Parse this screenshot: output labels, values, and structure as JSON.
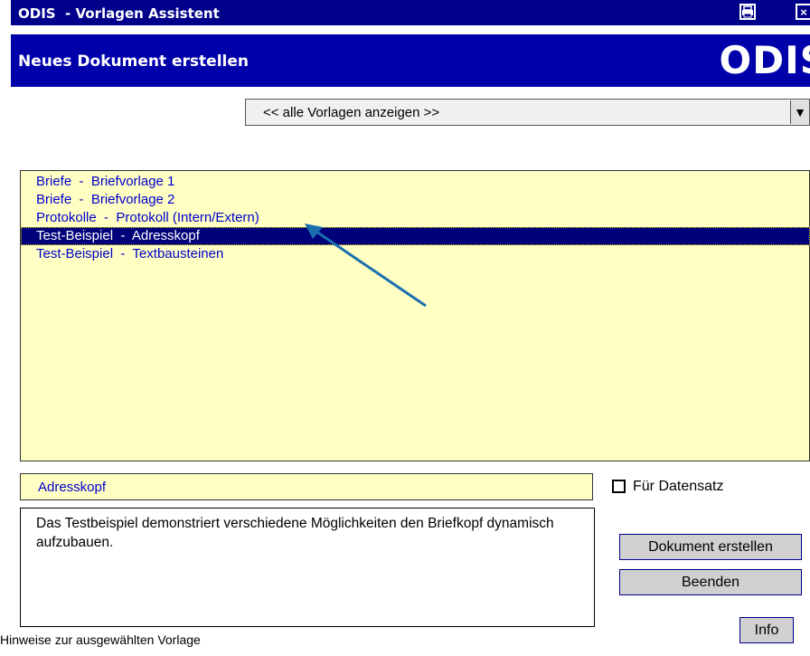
{
  "window": {
    "title": "ODIS  - Vorlagen Assistent",
    "print_icon": "printer-icon",
    "close_glyph": "×"
  },
  "header": {
    "subtitle": "Neues Dokument erstellen",
    "logo": "ODIS"
  },
  "filter": {
    "selected": "<< alle Vorlagen anzeigen >>",
    "arrow_glyph": "▼"
  },
  "templates": {
    "items": [
      {
        "label": "Briefe  -  Briefvorlage 1"
      },
      {
        "label": "Briefe  -  Briefvorlage 2"
      },
      {
        "label": "Protokolle  -  Protokoll (Intern/Extern)"
      },
      {
        "label": "Test-Beispiel  -  Adresskopf",
        "selected": true
      },
      {
        "label": "Test-Beispiel  -  Textbausteinen"
      }
    ]
  },
  "selected_template": {
    "name": "Adresskopf",
    "description": "Das Testbeispiel demonstriert verschiedene Möglichkeiten den Briefkopf dynamisch aufzubauen.",
    "hint": "Hinweise zur ausgewählten Vorlage"
  },
  "options": {
    "for_record_label": "Für Datensatz",
    "for_record_checked": false
  },
  "buttons": {
    "create": "Dokument erstellen",
    "quit": "Beenden",
    "info": "Info"
  },
  "colors": {
    "titlebar": "#00008b",
    "header": "#0000aa",
    "list_background": "#ffffc4",
    "list_text": "#0000cc",
    "selection": "#00007a",
    "annotation_arrow": "#1a6faf"
  }
}
